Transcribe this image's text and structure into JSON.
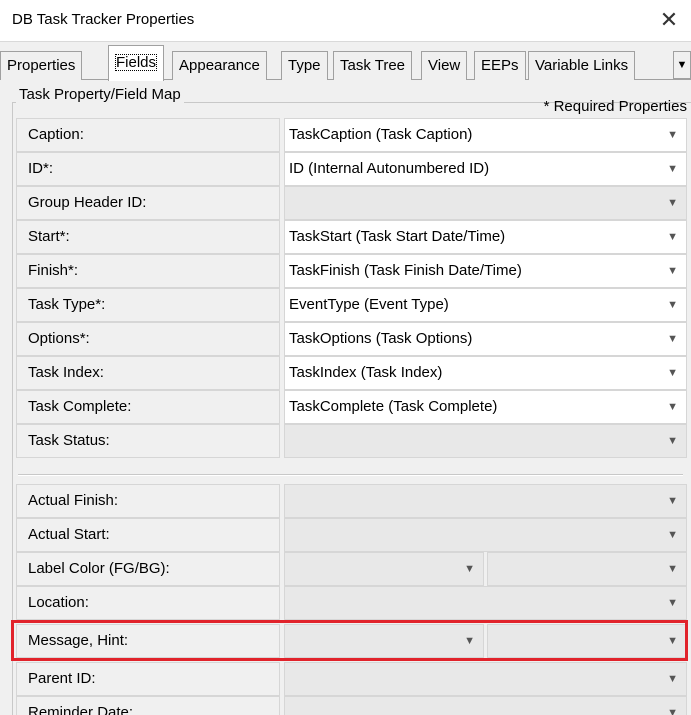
{
  "window": {
    "title": "DB Task Tracker  Properties"
  },
  "tabs": [
    {
      "label": "Properties"
    },
    {
      "label": "Fields"
    },
    {
      "label": "Appearance"
    },
    {
      "label": "Type"
    },
    {
      "label": "Task Tree"
    },
    {
      "label": "View"
    },
    {
      "label": "EEPs"
    },
    {
      "label": "Variable Links"
    }
  ],
  "active_tab": "Fields",
  "group": {
    "title": "Task Property/Field Map",
    "required_note": "* Required Properties"
  },
  "rows": [
    {
      "label": "Caption:",
      "value": "TaskCaption  (Task Caption)"
    },
    {
      "label": "ID*:",
      "value": "ID  (Internal Autonumbered ID)"
    },
    {
      "label": "Group Header ID:",
      "value": ""
    },
    {
      "label": "Start*:",
      "value": "TaskStart  (Task Start Date/Time)"
    },
    {
      "label": "Finish*:",
      "value": "TaskFinish  (Task Finish Date/Time)"
    },
    {
      "label": "Task Type*:",
      "value": "EventType  (Event Type)"
    },
    {
      "label": "Options*:",
      "value": "TaskOptions  (Task Options)"
    },
    {
      "label": "Task Index:",
      "value": "TaskIndex  (Task Index)"
    },
    {
      "label": "Task Complete:",
      "value": "TaskComplete  (Task Complete)"
    },
    {
      "label": "Task Status:",
      "value": ""
    },
    {
      "label": "Actual Finish:",
      "value": ""
    },
    {
      "label": "Actual Start:",
      "value": ""
    },
    {
      "label": "Label Color (FG/BG):",
      "value": "",
      "value2": ""
    },
    {
      "label": "Location:",
      "value": ""
    },
    {
      "label": "Message, Hint:",
      "value": "",
      "value2": ""
    },
    {
      "label": "Parent ID:",
      "value": ""
    },
    {
      "label": "Reminder Date:",
      "value": ""
    }
  ],
  "colors": {
    "highlight": "#e1232b"
  },
  "icons": {
    "close": "close-icon",
    "dropdown": "chevron-down-icon",
    "tab_scroll": "triangle-down-icon"
  }
}
